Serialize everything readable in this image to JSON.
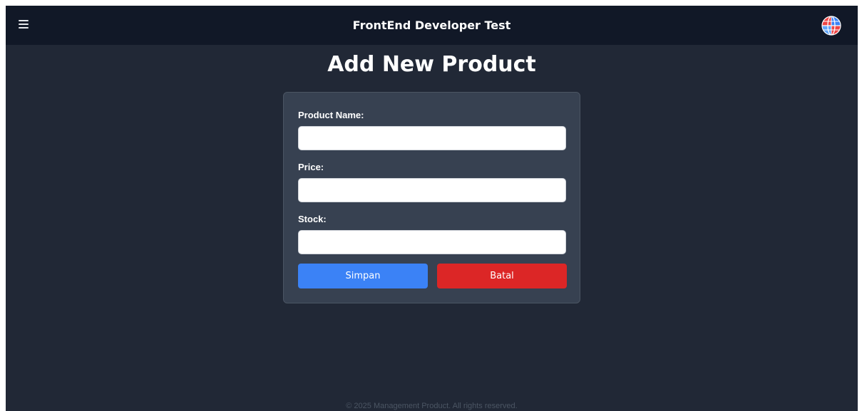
{
  "header": {
    "title": "FrontEnd Developer Test",
    "menu_icon": "hamburger-menu-icon",
    "avatar_icon": "globe-logo-avatar"
  },
  "page": {
    "title": "Add New Product"
  },
  "form": {
    "fields": [
      {
        "label": "Product Name:",
        "value": "",
        "placeholder": ""
      },
      {
        "label": "Price:",
        "value": "",
        "placeholder": ""
      },
      {
        "label": "Stock:",
        "value": "",
        "placeholder": ""
      }
    ],
    "save_label": "Simpan",
    "cancel_label": "Batal"
  },
  "footer": {
    "text": "© 2025 Management Product. All rights reserved."
  },
  "colors": {
    "background": "#212836",
    "topbar": "#111827",
    "card": "#374151",
    "save_button": "#3b82f6",
    "cancel_button": "#dc2626"
  }
}
